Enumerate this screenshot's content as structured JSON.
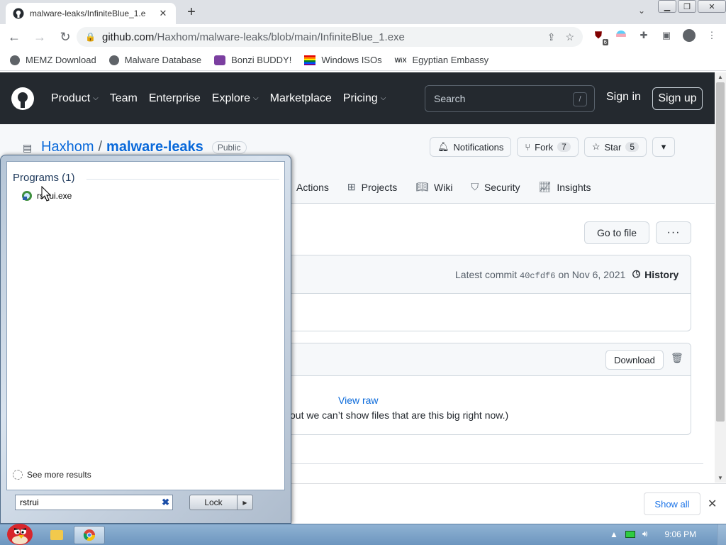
{
  "browser": {
    "tab_title": "malware-leaks/InfiniteBlue_1.e",
    "url_host": "github.com",
    "url_path": "/Haxhom/malware-leaks/blob/main/InfiniteBlue_1.exe",
    "extension_badge": "6",
    "bookmarks": [
      "MEMZ Download",
      "Malware Database",
      "Bonzi BUDDY!",
      "Windows ISOs",
      "Egyptian Embassy"
    ]
  },
  "github": {
    "nav": [
      "Product",
      "Team",
      "Enterprise",
      "Explore",
      "Marketplace",
      "Pricing"
    ],
    "search_placeholder": "Search",
    "search_shortcut": "/",
    "sign_in": "Sign in",
    "sign_up": "Sign up",
    "owner": "Haxhom",
    "repo": "malware-leaks",
    "visibility": "Public",
    "notifications": "Notifications",
    "fork_label": "Fork",
    "fork_count": "7",
    "star_label": "Star",
    "star_count": "5",
    "tabs": [
      "Actions",
      "Projects",
      "Wiki",
      "Security",
      "Insights"
    ],
    "go_to_file": "Go to file",
    "more": "···",
    "commit_prefix": "Latest commit",
    "commit_sha": "40cfdf6",
    "commit_date": "on Nov 6, 2021",
    "history": "History",
    "download": "Download",
    "view_raw": "View raw",
    "big_file_note": "out we can’t show files that are this big right now.)"
  },
  "download_bar": {
    "show_all": "Show all"
  },
  "start_menu": {
    "section_title": "Programs (1)",
    "result_name": "rstrui.exe",
    "see_more": "See more results",
    "search_value": "rstrui",
    "lock_label": "Lock"
  },
  "taskbar": {
    "clock": "9:06 PM"
  }
}
